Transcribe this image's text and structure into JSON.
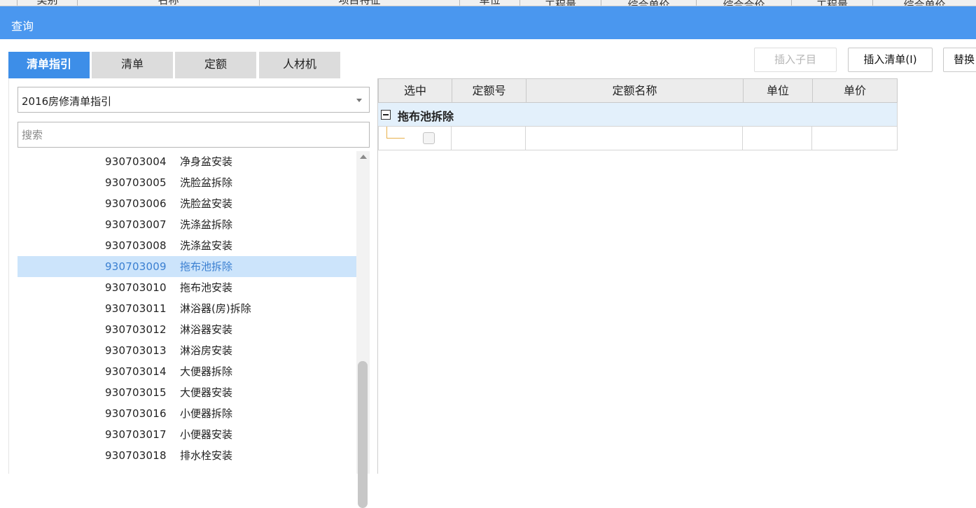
{
  "background_header": {
    "columns": [
      "类别",
      "名称",
      "项目特征",
      "单位",
      "工程量",
      "综合单价",
      "综合合价",
      "工程量",
      "综合单价"
    ]
  },
  "dialog": {
    "title": "查询"
  },
  "tabs": [
    {
      "label": "清单指引",
      "active": true
    },
    {
      "label": "清单",
      "active": false
    },
    {
      "label": "定额",
      "active": false
    },
    {
      "label": "人材机",
      "active": false
    }
  ],
  "toolbar": {
    "insert_child": "插入子目",
    "insert_list": "插入清单(I)",
    "replace": "替换"
  },
  "left": {
    "dropdown_value": "2016房修清单指引",
    "search_placeholder": "搜索",
    "items": [
      {
        "code": "930703004",
        "name": "净身盆安装"
      },
      {
        "code": "930703005",
        "name": "洗脸盆拆除"
      },
      {
        "code": "930703006",
        "name": "洗脸盆安装"
      },
      {
        "code": "930703007",
        "name": "洗涤盆拆除"
      },
      {
        "code": "930703008",
        "name": "洗涤盆安装"
      },
      {
        "code": "930703009",
        "name": "拖布池拆除",
        "selected": true
      },
      {
        "code": "930703010",
        "name": "拖布池安装"
      },
      {
        "code": "930703011",
        "name": "淋浴器(房)拆除"
      },
      {
        "code": "930703012",
        "name": "淋浴器安装"
      },
      {
        "code": "930703013",
        "name": "淋浴房安装"
      },
      {
        "code": "930703014",
        "name": "大便器拆除"
      },
      {
        "code": "930703015",
        "name": "大便器安装"
      },
      {
        "code": "930703016",
        "name": "小便器拆除"
      },
      {
        "code": "930703017",
        "name": "小便器安装"
      },
      {
        "code": "930703018",
        "name": "排水栓安装"
      }
    ]
  },
  "grid": {
    "columns": [
      "选中",
      "定额号",
      "定额名称",
      "单位",
      "单价"
    ],
    "group_label": "拖布池拆除"
  },
  "colors": {
    "title_bar": "#4a97ef",
    "active_tab": "#3d8ee8",
    "selected_row": "#cce4fb",
    "group_row": "#e3f0fb"
  }
}
